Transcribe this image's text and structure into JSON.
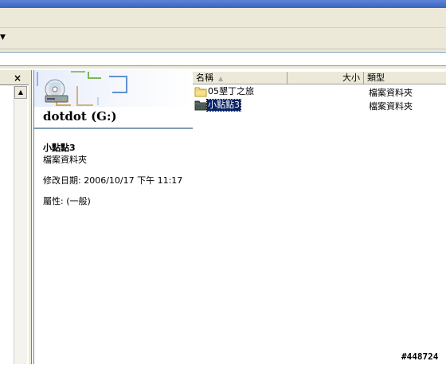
{
  "toolbar": {
    "chevron_icon": "chevron-down-icon"
  },
  "folders_pane": {
    "close_glyph": "×",
    "scroll_up_glyph": "▲"
  },
  "info_pane": {
    "drive_label": "dotdot (G:)",
    "selected_name": "小點點3",
    "selected_type": "檔案資料夾",
    "modified": "修改日期: 2006/10/17 下午 11:17",
    "attributes": "屬性: (一般)"
  },
  "file_list": {
    "columns": {
      "name": "名稱",
      "size": "大小",
      "type": "類型"
    },
    "sort_indicator": "▲",
    "rows": [
      {
        "name": "05墾丁之旅",
        "type": "檔案資料夾",
        "selected": false
      },
      {
        "name": "小點點3",
        "type": "檔案資料夾",
        "selected": true
      }
    ]
  },
  "watermark": "#448724",
  "colors": {
    "selection": "#0a246a",
    "chrome": "#ece9d8",
    "divider": "#7f9db9"
  }
}
